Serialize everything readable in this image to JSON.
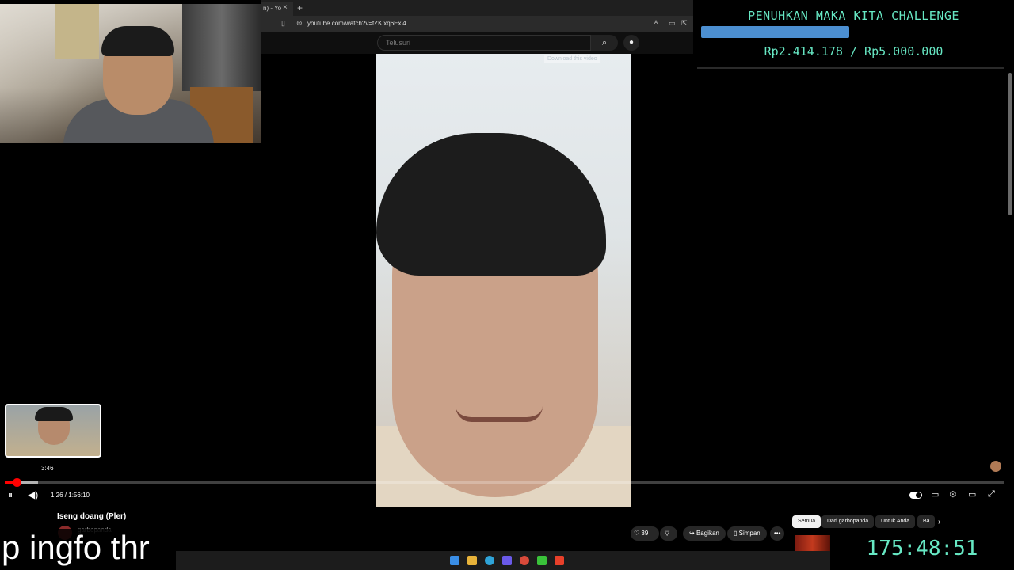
{
  "browser": {
    "tab_title": "n) - Yo",
    "close_icon": "close-icon",
    "new_tab": "+",
    "url": "youtube.com/watch?v=tZKlxq6Exl4"
  },
  "youtube": {
    "search_placeholder": "Telusuri",
    "video_overlay_label": "Download this video",
    "preview_time": "3:46",
    "time_display": "1:26 / 1:56:10",
    "progress_fraction": 0.012,
    "video_title": "Iseng doang (Pler)",
    "channel_name": "garbopanda",
    "like_count": "39",
    "share_label": "Bagikan",
    "save_label": "Simpan",
    "more_label": "•••",
    "chips": [
      "Semua",
      "Dari garbopanda",
      "Untuk Anda",
      "Ba"
    ]
  },
  "overlay": {
    "challenge_title": "PENUHKAN MAKA KITA CHALLENGE",
    "challenge_amount": "Rp2.414.178 / Rp5.000.000",
    "challenge_progress": 0.483,
    "timer": "175:48:51",
    "caption": "p ingfo thr",
    "accent_color": "#67e8c4",
    "bar_color": "#4c8fd1"
  },
  "icons": {
    "search": "⌕",
    "mic": "🎤",
    "pause": "⏸",
    "volume": "🔈",
    "settings": "⚙",
    "theater": "▭",
    "fullscreen": "⛶",
    "like": "👍",
    "dislike": "👎",
    "share": "↪",
    "save": "🔖",
    "chevron": "›"
  }
}
